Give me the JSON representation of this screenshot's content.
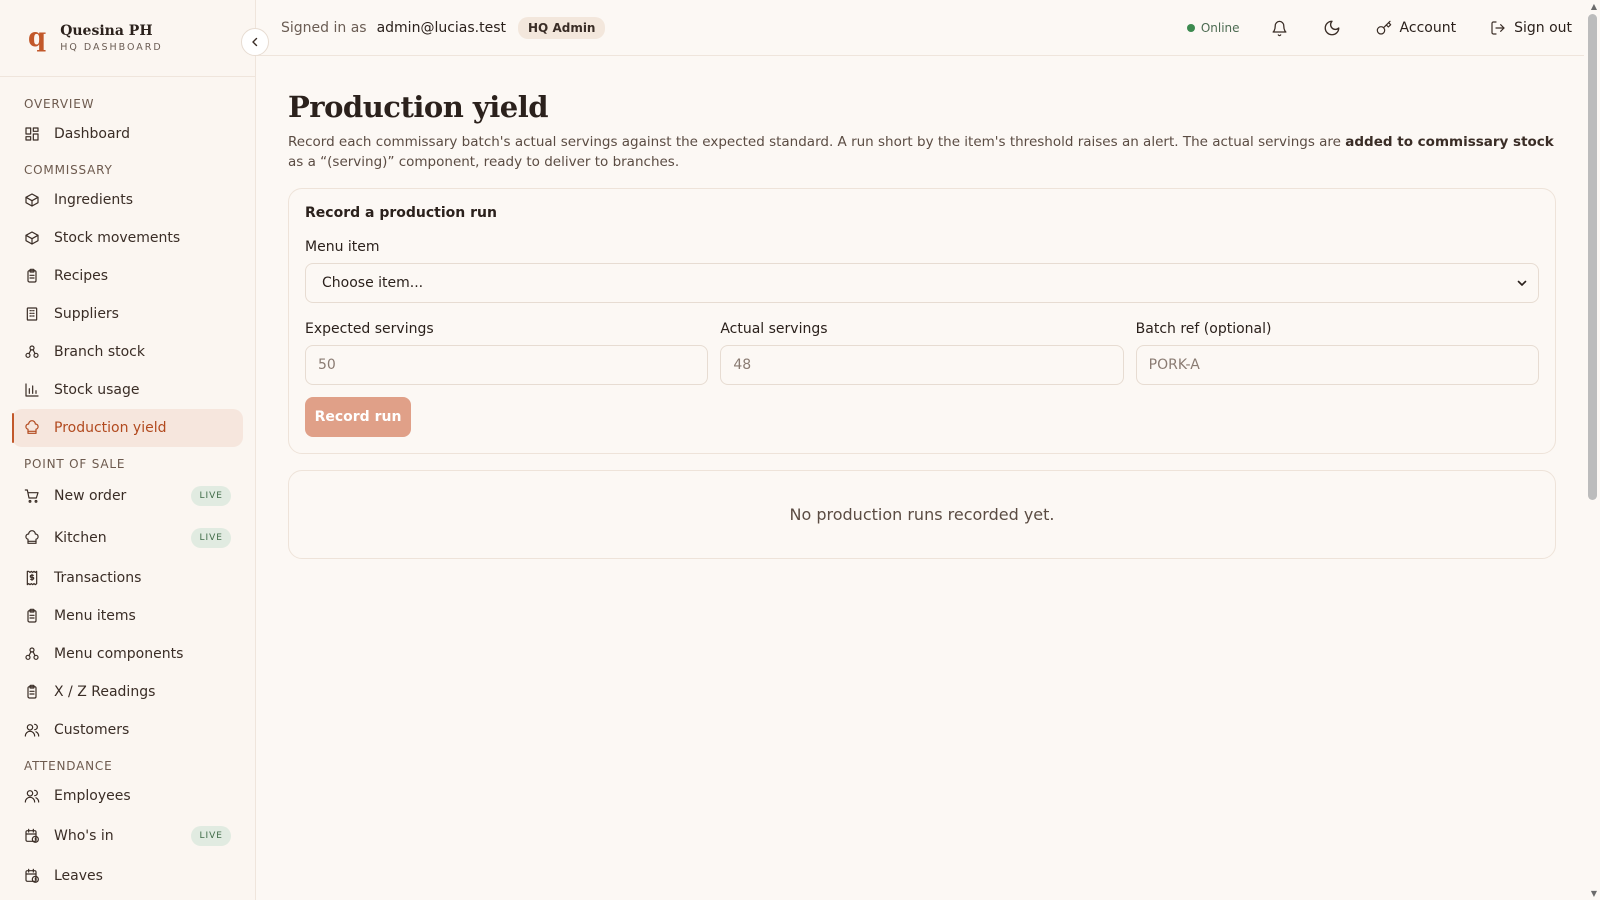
{
  "brand": {
    "logo": "q",
    "name": "Quesina PH",
    "sub": "HQ DASHBOARD"
  },
  "sidebar": {
    "sections": [
      {
        "label": "OVERVIEW",
        "items": [
          {
            "label": "Dashboard",
            "icon": "grid-icon"
          }
        ]
      },
      {
        "label": "COMMISSARY",
        "items": [
          {
            "label": "Ingredients",
            "icon": "package-icon"
          },
          {
            "label": "Stock movements",
            "icon": "package-icon"
          },
          {
            "label": "Recipes",
            "icon": "clipboard-icon"
          },
          {
            "label": "Suppliers",
            "icon": "building-icon"
          },
          {
            "label": "Branch stock",
            "icon": "network-icon"
          },
          {
            "label": "Stock usage",
            "icon": "bar-chart-icon"
          },
          {
            "label": "Production yield",
            "icon": "chef-hat-icon",
            "active": true
          }
        ]
      },
      {
        "label": "POINT OF SALE",
        "items": [
          {
            "label": "New order",
            "icon": "cart-icon",
            "badge": "LIVE"
          },
          {
            "label": "Kitchen",
            "icon": "chef-hat-icon",
            "badge": "LIVE"
          },
          {
            "label": "Transactions",
            "icon": "receipt-icon"
          },
          {
            "label": "Menu items",
            "icon": "clipboard-icon"
          },
          {
            "label": "Menu components",
            "icon": "network-icon"
          },
          {
            "label": "X / Z Readings",
            "icon": "clipboard-icon"
          },
          {
            "label": "Customers",
            "icon": "users-icon"
          }
        ]
      },
      {
        "label": "ATTENDANCE",
        "items": [
          {
            "label": "Employees",
            "icon": "users-icon"
          },
          {
            "label": "Who's in",
            "icon": "calendar-clock-icon",
            "badge": "LIVE"
          },
          {
            "label": "Leaves",
            "icon": "calendar-clock-icon"
          }
        ]
      }
    ]
  },
  "header": {
    "signed_in_label": "Signed in as",
    "email": "admin@lucias.test",
    "role": "HQ Admin",
    "status": "Online",
    "account": "Account",
    "sign_out": "Sign out"
  },
  "main": {
    "title": "Production yield",
    "desc_part1": "Record each commissary batch's actual servings against the expected standard. A run short by the item's threshold raises an alert. The actual servings are ",
    "desc_bold": "added to commissary stock",
    "desc_part2": " as a “(serving)” component, ready to deliver to branches.",
    "form": {
      "title": "Record a production run",
      "menu_item_label": "Menu item",
      "menu_item_value": "Choose item...",
      "expected_label": "Expected servings",
      "expected_placeholder": "50",
      "actual_label": "Actual servings",
      "actual_placeholder": "48",
      "batch_label": "Batch ref (optional)",
      "batch_placeholder": "PORK-A",
      "submit": "Record run"
    },
    "empty_message": "No production runs recorded yet."
  },
  "colors": {
    "accent": "#c2582a",
    "active_bg": "#f6e6dd",
    "live_badge_bg": "#e1ebe1",
    "button_bg": "#e0a088"
  }
}
